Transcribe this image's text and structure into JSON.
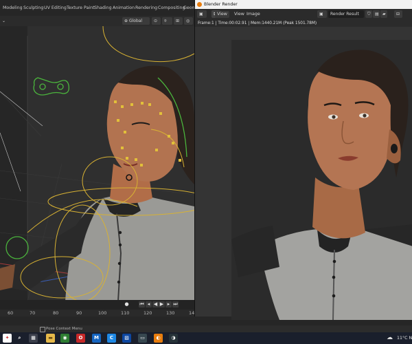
{
  "workspace_tabs": [
    "Modeling",
    "Sculpting",
    "UV Editing",
    "Texture Paint",
    "Shading",
    "Animation",
    "Rendering",
    "Compositing",
    "Geom"
  ],
  "viewport_header": {
    "transform_orientation": "Global"
  },
  "timeline": {
    "ruler_numbers": [
      "60",
      "70",
      "80",
      "90",
      "100",
      "110",
      "120",
      "130",
      "140"
    ]
  },
  "status_bar": {
    "text": "Pose Context Menu"
  },
  "render_window": {
    "title": "Blender Render",
    "menu": {
      "view": "View",
      "image": "Image"
    },
    "image_name": "Render Result",
    "info": "Frame:1 | Time:00:02.91 | Mem:1440.21M (Peak 1501.78M)"
  },
  "taskbar": {
    "tray": "11°C N"
  },
  "colors": {
    "titlebar": "#f2f2f2",
    "viewport_bg": "#2f2f2f",
    "rig_yellow": "#d8b233",
    "rig_green": "#4bb53d",
    "axis_red": "#a83b3b",
    "axis_blue": "#3a5fb8",
    "taskbar": "#1a1f2c"
  }
}
